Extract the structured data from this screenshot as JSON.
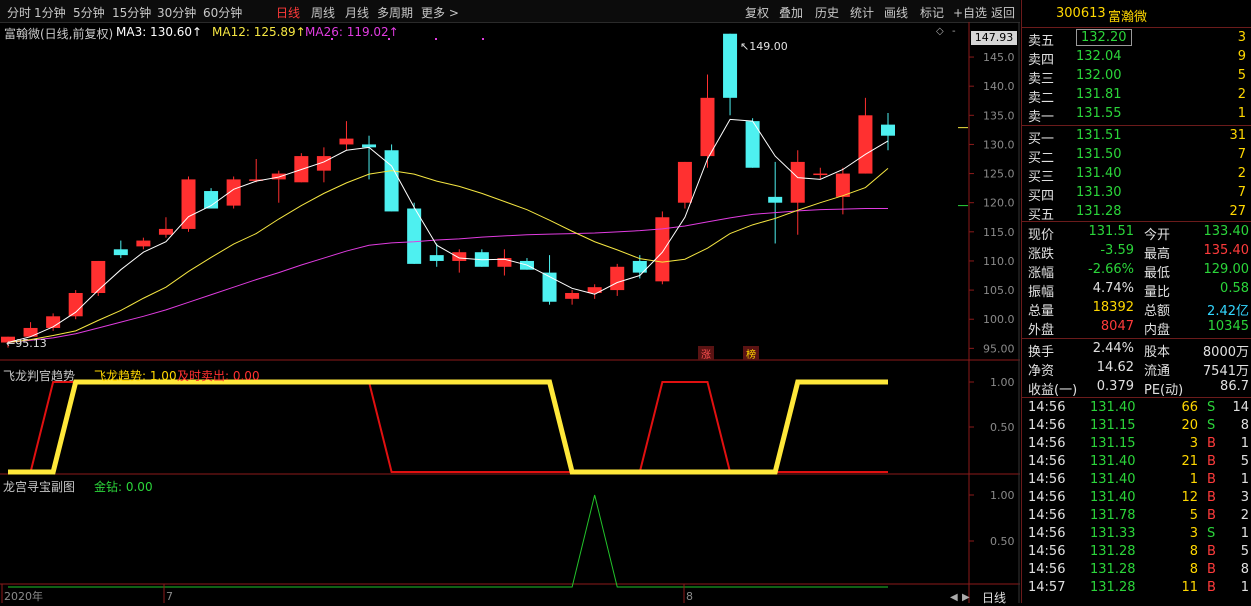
{
  "toolbar": {
    "left": [
      "分时",
      "1分钟",
      "5分钟",
      "15分钟",
      "30分钟",
      "60分钟",
      "日线",
      "周线",
      "月线",
      "多周期",
      "更多 >"
    ],
    "right": [
      "复权",
      "叠加",
      "历史",
      "统计",
      "画线",
      "标记",
      "+自选",
      "返回"
    ],
    "active": "日线"
  },
  "main": {
    "title": "富翰微(日线,前复权)",
    "ma3": "MA3: 130.60↑",
    "ma12": "MA12: 125.89↑",
    "ma26": "MA26: 119.02↑",
    "price_box": "147.93",
    "high_mark": "149.00",
    "low_mark": "95.13",
    "tags": [
      "涨",
      "榜"
    ],
    "y_ticks": [
      "145.0",
      "140.0",
      "135.0",
      "130.0",
      "125.0",
      "120.0",
      "115.0",
      "110.0",
      "105.0",
      "100.0",
      "95.00"
    ]
  },
  "indicator1": {
    "name": "飞龙判官趋势",
    "trend": "飞龙趋势: 1.00",
    "sell": "及时卖出: 0.00",
    "y_ticks": [
      "1.00",
      "0.50"
    ]
  },
  "indicator2": {
    "name": "龙宫寻宝副图",
    "gold": "金钻: 0.00",
    "y_ticks": [
      "1.00",
      "0.50"
    ]
  },
  "xaxis": {
    "labels": [
      "2020年",
      "7",
      "8"
    ],
    "period": "日线"
  },
  "colors": {
    "up": "#ff3030",
    "down": "#4ef0f0",
    "ma3": "#ffffff",
    "ma12": "#f5e642",
    "ma26": "#e03ce0"
  },
  "chart_data": {
    "type": "candlestick",
    "ohlc": [
      [
        96.0,
        97.0,
        95.13,
        97.0
      ],
      [
        97.0,
        99.5,
        97.0,
        98.5
      ],
      [
        98.5,
        101,
        98.0,
        100.5
      ],
      [
        100.5,
        105,
        100.0,
        104.5
      ],
      [
        104.5,
        110,
        104.0,
        110.0
      ],
      [
        112.0,
        113.5,
        110.5,
        111.0
      ],
      [
        112.5,
        114.0,
        112.0,
        113.5
      ],
      [
        114.5,
        117.5,
        114.0,
        115.5
      ],
      [
        115.5,
        124.5,
        115.0,
        124.0
      ],
      [
        122.0,
        122.5,
        119.0,
        119.0
      ],
      [
        119.5,
        124.5,
        119.0,
        124.0
      ],
      [
        124.0,
        127.5,
        123.5,
        124.0
      ],
      [
        124.0,
        125.5,
        120.0,
        125.0
      ],
      [
        123.5,
        128.5,
        123.5,
        128.0
      ],
      [
        125.5,
        129.5,
        123.5,
        128.0
      ],
      [
        130.0,
        134.0,
        129.0,
        131.0
      ],
      [
        130.0,
        131.5,
        124.0,
        129.5
      ],
      [
        129.0,
        130.0,
        118.5,
        118.5
      ],
      [
        119.0,
        120.0,
        109.5,
        109.5
      ],
      [
        111.0,
        113.0,
        109.0,
        110.0
      ],
      [
        110.0,
        112.0,
        108.0,
        111.5
      ],
      [
        111.5,
        112.0,
        109.0,
        109.0
      ],
      [
        109.0,
        112.0,
        107.5,
        110.5
      ],
      [
        110.0,
        110.5,
        108.5,
        108.5
      ],
      [
        108.0,
        111.0,
        102.5,
        103.0
      ],
      [
        103.5,
        105.0,
        102.5,
        104.5
      ],
      [
        104.5,
        106.0,
        103.5,
        105.5
      ],
      [
        105.0,
        109.5,
        104.0,
        109.0
      ],
      [
        110.0,
        111.0,
        107.0,
        108.0
      ],
      [
        106.5,
        118.5,
        106.0,
        117.5
      ],
      [
        120.0,
        127.0,
        119.0,
        127.0
      ],
      [
        128.0,
        142.0,
        126.0,
        138.0
      ],
      [
        149.0,
        149.0,
        135.0,
        138.0
      ],
      [
        134.0,
        134.5,
        126.0,
        126.0
      ],
      [
        121.0,
        127.0,
        113.0,
        120.0
      ],
      [
        120.0,
        129.0,
        114.5,
        127.0
      ],
      [
        125.0,
        126.0,
        124.0,
        125.0
      ],
      [
        121.0,
        126.0,
        118.0,
        125.0
      ],
      [
        125.0,
        138.0,
        125.0,
        135.0
      ],
      [
        133.4,
        135.4,
        129.0,
        131.5
      ]
    ],
    "ma3": [
      96.0,
      97.0,
      98.7,
      101.2,
      105.0,
      108.5,
      111.5,
      113.3,
      117.6,
      119.5,
      122.3,
      123.7,
      124.4,
      125.7,
      127.0,
      129.0,
      129.5,
      126.3,
      119.2,
      112.7,
      110.5,
      110.2,
      110.3,
      109.3,
      107.3,
      105.3,
      104.3,
      106.3,
      107.5,
      111.5,
      117.5,
      127.5,
      134.3,
      134.0,
      128.0,
      124.3,
      124.0,
      125.7,
      128.3,
      130.6
    ],
    "ma12": [
      96.0,
      96.5,
      97.2,
      98.0,
      99.8,
      101.5,
      103.6,
      105.5,
      108.2,
      110.6,
      112.9,
      114.7,
      117.2,
      119.5,
      121.6,
      123.4,
      124.9,
      125.5,
      124.9,
      123.7,
      122.8,
      121.6,
      120.2,
      118.8,
      117.0,
      115.1,
      113.3,
      111.9,
      110.4,
      109.8,
      110.3,
      112.2,
      114.7,
      116.2,
      117.3,
      118.7,
      120.0,
      121.2,
      122.6,
      125.9
    ],
    "ma26": [
      96.0,
      96.4,
      96.8,
      97.5,
      98.5,
      99.5,
      100.5,
      101.6,
      102.9,
      104.2,
      105.5,
      106.8,
      108.0,
      109.3,
      110.5,
      111.7,
      112.7,
      113.1,
      113.3,
      113.6,
      113.8,
      114.1,
      114.3,
      114.5,
      114.6,
      114.7,
      114.8,
      115.0,
      115.2,
      115.5,
      116.0,
      116.7,
      117.4,
      118.0,
      118.3,
      118.6,
      118.8,
      118.9,
      119.0,
      119.0
    ],
    "fl_trend": [
      0,
      0,
      0,
      1,
      1,
      1,
      1,
      1,
      1,
      1,
      1,
      1,
      1,
      1,
      1,
      1,
      1,
      1,
      1,
      1,
      1,
      1,
      1,
      1,
      1,
      0,
      0,
      0,
      0,
      0,
      0,
      0,
      0,
      0,
      0,
      1,
      1,
      1,
      1,
      1
    ],
    "fl_sell": [
      0,
      0,
      1,
      1,
      1,
      1,
      1,
      1,
      1,
      1,
      1,
      1,
      1,
      1,
      1,
      1,
      1,
      0,
      0,
      0,
      0,
      0,
      0,
      0,
      0,
      0,
      0,
      0,
      0,
      1,
      1,
      1,
      0,
      0,
      0,
      0,
      0,
      0,
      0,
      0
    ],
    "gold": [
      0,
      0,
      0,
      0,
      0,
      0,
      0,
      0,
      0,
      0,
      0,
      0,
      0,
      0,
      0,
      0,
      0,
      0,
      0,
      0,
      0,
      0,
      0,
      0,
      0,
      0,
      1,
      0,
      0,
      0,
      0,
      0,
      0,
      0,
      0,
      0,
      0,
      0,
      0,
      0
    ]
  },
  "quote": {
    "code": "300613",
    "name": "富瀚微",
    "asks": [
      {
        "label": "卖五",
        "price": "132.20",
        "vol": "3"
      },
      {
        "label": "卖四",
        "price": "132.04",
        "vol": "9"
      },
      {
        "label": "卖三",
        "price": "132.00",
        "vol": "5"
      },
      {
        "label": "卖二",
        "price": "131.81",
        "vol": "2"
      },
      {
        "label": "卖一",
        "price": "131.55",
        "vol": "1"
      }
    ],
    "bids": [
      {
        "label": "买一",
        "price": "131.51",
        "vol": "31"
      },
      {
        "label": "买二",
        "price": "131.50",
        "vol": "7"
      },
      {
        "label": "买三",
        "price": "131.40",
        "vol": "2"
      },
      {
        "label": "买四",
        "price": "131.30",
        "vol": "7"
      },
      {
        "label": "买五",
        "price": "131.28",
        "vol": "27"
      }
    ],
    "stats": [
      {
        "l1": "现价",
        "v1": "131.51",
        "c1": "green",
        "l2": "今开",
        "v2": "133.40",
        "c2": "green"
      },
      {
        "l1": "涨跌",
        "v1": "-3.59",
        "c1": "green",
        "l2": "最高",
        "v2": "135.40",
        "c2": "red"
      },
      {
        "l1": "涨幅",
        "v1": "-2.66%",
        "c1": "green",
        "l2": "最低",
        "v2": "129.00",
        "c2": "green"
      },
      {
        "l1": "振幅",
        "v1": "4.74%",
        "c1": "white",
        "l2": "量比",
        "v2": "0.58",
        "c2": "green"
      },
      {
        "l1": "总量",
        "v1": "18392",
        "c1": "yellow",
        "l2": "总额",
        "v2": "2.42亿",
        "c2": "cyan"
      },
      {
        "l1": "外盘",
        "v1": "8047",
        "c1": "red",
        "l2": "内盘",
        "v2": "10345",
        "c2": "green"
      }
    ],
    "stats2": [
      {
        "l1": "换手",
        "v1": "2.44%",
        "l2": "股本",
        "v2": "8000万"
      },
      {
        "l1": "净资",
        "v1": "14.62",
        "l2": "流通",
        "v2": "7541万"
      },
      {
        "l1": "收益(一)",
        "v1": "0.379",
        "l2": "PE(动)",
        "v2": "86.7"
      }
    ],
    "ticks": [
      {
        "t": "14:56",
        "p": "131.40",
        "v": "66",
        "s": "S",
        "n": "14",
        "pc": "green",
        "vc": "yellow"
      },
      {
        "t": "14:56",
        "p": "131.15",
        "v": "20",
        "s": "S",
        "n": "8",
        "pc": "green",
        "vc": "yellow"
      },
      {
        "t": "14:56",
        "p": "131.15",
        "v": "3",
        "s": "B",
        "n": "1",
        "pc": "green",
        "vc": "yellow"
      },
      {
        "t": "14:56",
        "p": "131.40",
        "v": "21",
        "s": "B",
        "n": "5",
        "pc": "green",
        "vc": "yellow"
      },
      {
        "t": "14:56",
        "p": "131.40",
        "v": "1",
        "s": "B",
        "n": "1",
        "pc": "green",
        "vc": "yellow"
      },
      {
        "t": "14:56",
        "p": "131.40",
        "v": "12",
        "s": "B",
        "n": "3",
        "pc": "green",
        "vc": "yellow"
      },
      {
        "t": "14:56",
        "p": "131.78",
        "v": "5",
        "s": "B",
        "n": "2",
        "pc": "green",
        "vc": "yellow"
      },
      {
        "t": "14:56",
        "p": "131.33",
        "v": "3",
        "s": "S",
        "n": "1",
        "pc": "green",
        "vc": "yellow"
      },
      {
        "t": "14:56",
        "p": "131.28",
        "v": "8",
        "s": "B",
        "n": "5",
        "pc": "green",
        "vc": "yellow"
      },
      {
        "t": "14:56",
        "p": "131.28",
        "v": "8",
        "s": "B",
        "n": "8",
        "pc": "green",
        "vc": "yellow"
      },
      {
        "t": "14:57",
        "p": "131.28",
        "v": "11",
        "s": "B",
        "n": "1",
        "pc": "green",
        "vc": "yellow"
      }
    ]
  }
}
